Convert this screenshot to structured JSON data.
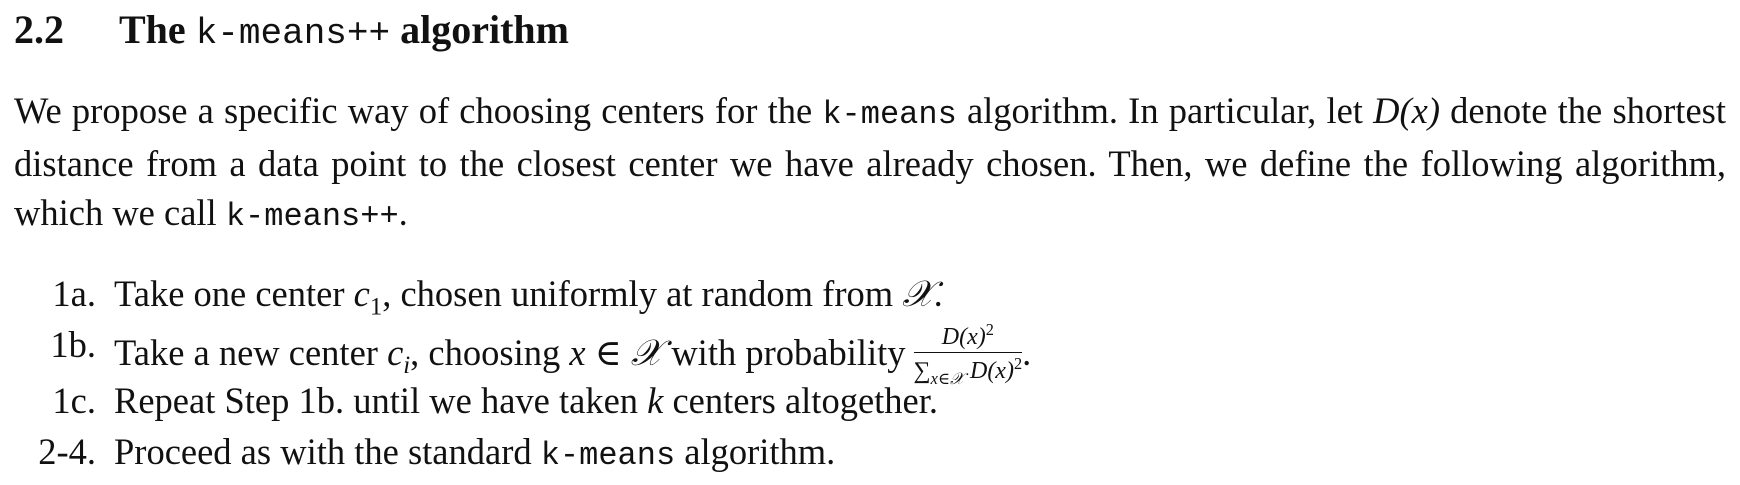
{
  "section": {
    "number": "2.2",
    "title_before": "The ",
    "title_code": "k-means++",
    "title_after": " algorithm"
  },
  "intro": {
    "p1_a": "We propose a specific way of choosing centers for the ",
    "p1_code": "k-means",
    "p1_b": " algorithm. In particular, let ",
    "p1_math": "D(x)",
    "p1_c": " denote the shortest distance from a data point to the closest center we have already chosen. Then, we define the following algorithm, which we call ",
    "p1_code2": "k-means++",
    "p1_d": "."
  },
  "steps": [
    {
      "label": "1a.",
      "text_a": "Take one center ",
      "math_var": "c",
      "math_sub": "1",
      "text_b": ", chosen uniformly at random from ",
      "math_set": "𝒳",
      "text_c": "."
    },
    {
      "label": "1b.",
      "text_a": "Take a new center ",
      "math_var": "c",
      "math_sub": "i",
      "text_b": ", choosing ",
      "math_expr": "x ∈ 𝒳",
      "text_c": " with probability",
      "frac_num": "D(x)",
      "frac_num_sup": "2",
      "frac_den_sum": "∑",
      "frac_den_sub": "x∈𝒳",
      "frac_den": " D(x)",
      "frac_den_sup": "2",
      "text_d": "."
    },
    {
      "label": "1c.",
      "text_a": "Repeat Step 1b. until we have taken ",
      "math_var": "k",
      "text_b": " centers altogether."
    },
    {
      "label": "2-4.",
      "text_a": "Proceed as with the standard ",
      "code": "k-means",
      "text_b": " algorithm."
    }
  ]
}
